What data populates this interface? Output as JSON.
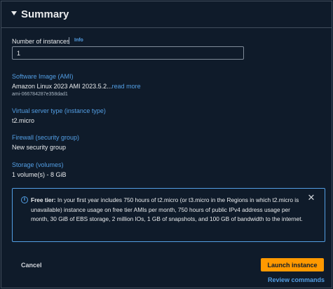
{
  "summary": {
    "title": "Summary"
  },
  "instances": {
    "label": "Number of instances",
    "info": "Info",
    "value": "1"
  },
  "ami": {
    "label": "Software Image (AMI)",
    "value": "Amazon Linux 2023 AMI 2023.5.2...",
    "read_more": "read more",
    "id": "ami-066784287e358dad1"
  },
  "instance_type": {
    "label": "Virtual server type (instance type)",
    "value": "t2.micro"
  },
  "firewall": {
    "label": "Firewall (security group)",
    "value": "New security group"
  },
  "storage": {
    "label": "Storage (volumes)",
    "value": "1 volume(s) - 8 GiB"
  },
  "free_tier": {
    "heading": "Free tier:",
    "text": " In your first year includes 750 hours of t2.micro (or t3.micro in the Regions in which t2.micro is unavailable) instance usage on free tier AMIs per month, 750 hours of public IPv4 address usage per month, 30 GiB of EBS storage, 2 million IOs, 1 GB of snapshots, and 100 GB of bandwidth to the internet."
  },
  "footer": {
    "cancel": "Cancel",
    "launch": "Launch instance",
    "review": "Review commands"
  },
  "colors": {
    "background": "#0f1b2a",
    "link": "#539fe5",
    "primary_button": "#ff9900",
    "border": "#414d5c"
  }
}
